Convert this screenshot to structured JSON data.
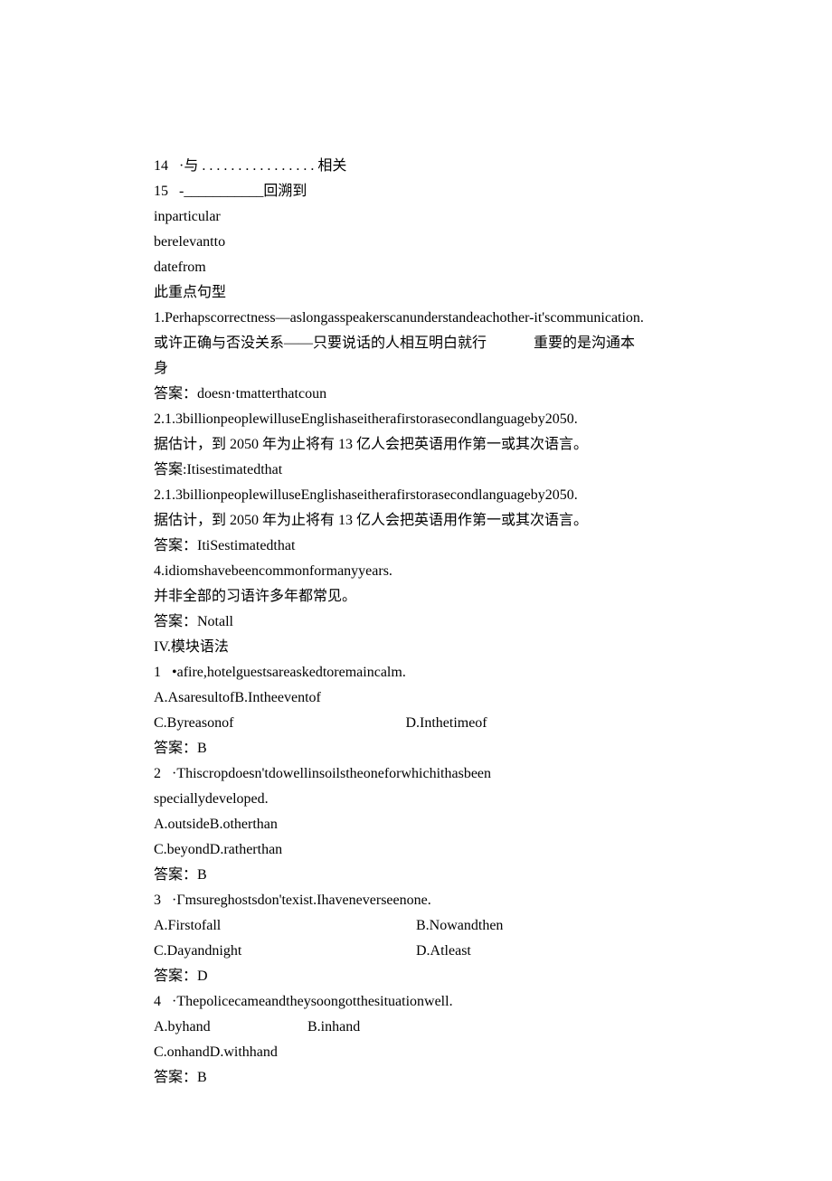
{
  "lines": {
    "l14": "14   ·与 . . . . . . . . . . . . . . . . 相关",
    "l15": "15   -___________回溯到",
    "l16": "inparticular",
    "l17": "berelevantto",
    "l18": "datefrom",
    "l19": "此重点句型",
    "l20": "1.Perhapscorrectness—aslongasspeakerscanunderstandeachother-it'scommunication.",
    "l21a": "或许正确与否没关系——只要说话的人相互明白就行",
    "l21b": "重要的是沟通本",
    "l22": "身",
    "l23": "答案：doesn·tmatterthatcoun",
    "l24": "2.1.3billionpeoplewilluseEnglishaseitherafirstorasecondlanguageby2050.",
    "l25": "据估计，到 2050 年为止将有 13 亿人会把英语用作第一或其次语言。",
    "l26": "答案:Itisestimatedthat",
    "l27": "2.1.3billionpeoplewilluseEnglishaseitherafirstorasecondlanguageby2050.",
    "l28": "据估计，到 2050 年为止将有 13 亿人会把英语用作第一或其次语言。",
    "l29": "答案：ItiSestimatedthat",
    "l30": "4.idiomshavebeencommonformanyyears.",
    "l31": "并非全部的习语许多年都常见。",
    "l32": "答案：Notall",
    "l33": "IV.模块语法",
    "l34": "1   •afire,hotelguestsareaskedtoremaincalm.",
    "l35": "A.AsaresultofB.Intheeventof",
    "l36a": "C.Byreasonof",
    "l36b": "D.Inthetimeof",
    "l37": "答案：B",
    "l38": "2   ·Thiscropdoesn'tdowellinsoilstheoneforwhichithasbeen",
    "l39": "speciallydeveloped.",
    "l40": "A.outsideB.otherthan",
    "l41": "C.beyondD.ratherthan",
    "l42": "答案：B",
    "l43": "3   ·Γmsureghostsdon'texist.Ihaveneverseenone.",
    "l44a": "A.Firstofall",
    "l44b": "B.Nowandthen",
    "l45a": "C.Dayandnight",
    "l45b": "D.Atleast",
    "l46": "答案：D",
    "l47": "4   ·Thepolicecameandtheysoongotthesituationwell.",
    "l48a": "A.byhand",
    "l48b": "B.inhand",
    "l49": "C.onhandD.withhand",
    "l50": "答案：B"
  }
}
